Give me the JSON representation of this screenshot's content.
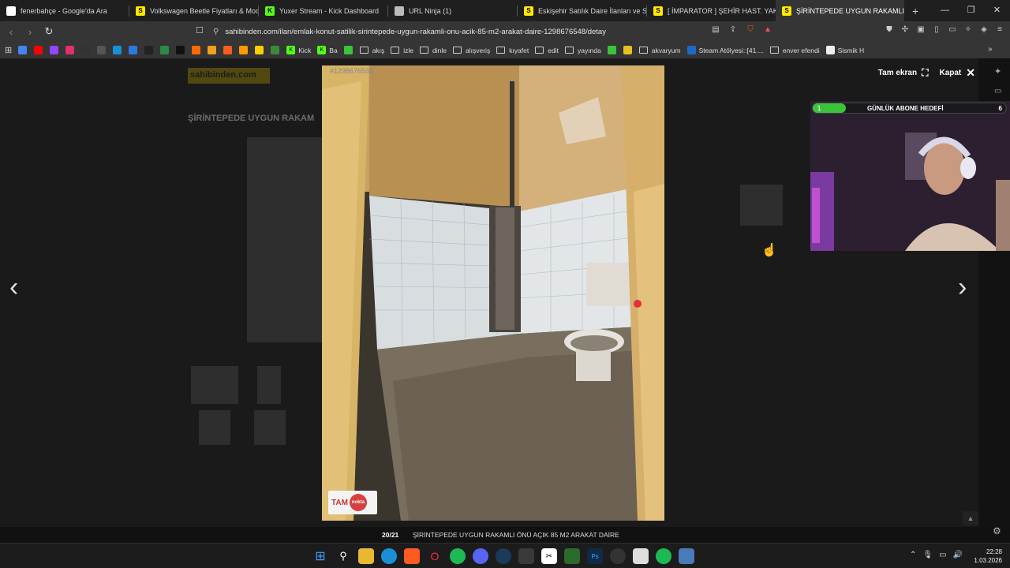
{
  "tabs": [
    {
      "title": "fenerbahçe - Google'da Ara",
      "icon": "google-icon",
      "color": "#ffffff"
    },
    {
      "title": "Volkswagen Beetle Fiyatları & Mode",
      "icon": "sahibinden-icon",
      "color": "#ffe800"
    },
    {
      "title": "Yuxer Stream - Kick Dashboard",
      "icon": "kick-icon",
      "color": "#53fc18"
    },
    {
      "title": "URL Ninja (1)",
      "icon": "ninja-icon",
      "color": "#bbbbbb"
    },
    {
      "title": "Eskişehir Satılık Daire İlanları ve Satıl",
      "icon": "sahibinden-icon",
      "color": "#ffe800"
    },
    {
      "title": "[ İMPARATOR ] ŞEHİR HAST. YAKINI (",
      "icon": "sahibinden-icon",
      "color": "#ffe800"
    },
    {
      "title": "ŞİRİNTEPEDE UYGUN RAKAMLI",
      "icon": "sahibinden-icon",
      "color": "#ffe800",
      "active": true
    }
  ],
  "url": "sahibinden.com/ilan/emlak-konut-satilik-sirintepede-uygun-rakamli-onu-acik-85-m2-arakat-daire-1298676548/detay",
  "bookmarks": [
    {
      "label": "",
      "icon": "google-icon"
    },
    {
      "label": "",
      "icon": "youtube-icon"
    },
    {
      "label": "",
      "icon": "twitch-icon"
    },
    {
      "label": "",
      "icon": "instagram-icon"
    },
    {
      "label": "",
      "icon": "x-icon"
    },
    {
      "label": "",
      "icon": "github-icon"
    },
    {
      "label": "",
      "icon": "cloud-icon"
    },
    {
      "label": "",
      "icon": "play-icon"
    },
    {
      "label": "",
      "icon": "wm-icon"
    },
    {
      "label": "",
      "icon": "leaf-icon"
    },
    {
      "label": "",
      "icon": "tiktok-icon"
    },
    {
      "label": "",
      "icon": "hb-icon"
    },
    {
      "label": "",
      "icon": "coin-icon"
    },
    {
      "label": "",
      "icon": "m-icon"
    },
    {
      "label": "",
      "icon": "amazon-icon"
    },
    {
      "label": "",
      "icon": "bolt-icon"
    },
    {
      "label": "",
      "icon": "bird-icon"
    },
    {
      "label": "Kick",
      "icon": "kick-icon"
    },
    {
      "label": "Ba",
      "icon": "kick-icon"
    },
    {
      "label": "",
      "icon": "green-circle-icon"
    },
    {
      "label": "akış",
      "icon": "folder-icon"
    },
    {
      "label": "izle",
      "icon": "folder-icon"
    },
    {
      "label": "dinle",
      "icon": "folder-icon"
    },
    {
      "label": "alışveriş",
      "icon": "folder-icon"
    },
    {
      "label": "kıyafet",
      "icon": "folder-icon"
    },
    {
      "label": "edit",
      "icon": "folder-icon"
    },
    {
      "label": "yayında",
      "icon": "folder-icon"
    },
    {
      "label": "",
      "icon": "q-icon"
    },
    {
      "label": "",
      "icon": "yellow-icon"
    },
    {
      "label": "akvaryum",
      "icon": "folder-icon"
    },
    {
      "label": "Steam Atölyesi::[41....",
      "icon": "steam-icon"
    },
    {
      "label": "enver efendi",
      "icon": "folder-icon"
    },
    {
      "label": "Sismik H",
      "icon": "globe-icon"
    }
  ],
  "gallery": {
    "listing_id": "#1298676548",
    "counter": "20/21",
    "caption": "ŞİRİNTEPEDE UYGUN RAKAMLI ÖNÜ AÇIK 85 M2 ARAKAT DAİRE",
    "fullscreen_label": "Tam ekran",
    "close_label": "Kapat",
    "watermark_text": "TAM",
    "watermark_sub": "nokta"
  },
  "background_site": {
    "logo": "sahibinden.com",
    "title": "ŞİRİNTEPEDE UYGUN RAKAM"
  },
  "overlay": {
    "sub_goal_start": "1",
    "sub_goal_title": "GÜNLÜK ABONE HEDEFİ",
    "sub_goal_end": "6",
    "sub_goal_progress": 0.17
  },
  "taskbar": {
    "time": "22:28",
    "date": "1.03.2026"
  }
}
